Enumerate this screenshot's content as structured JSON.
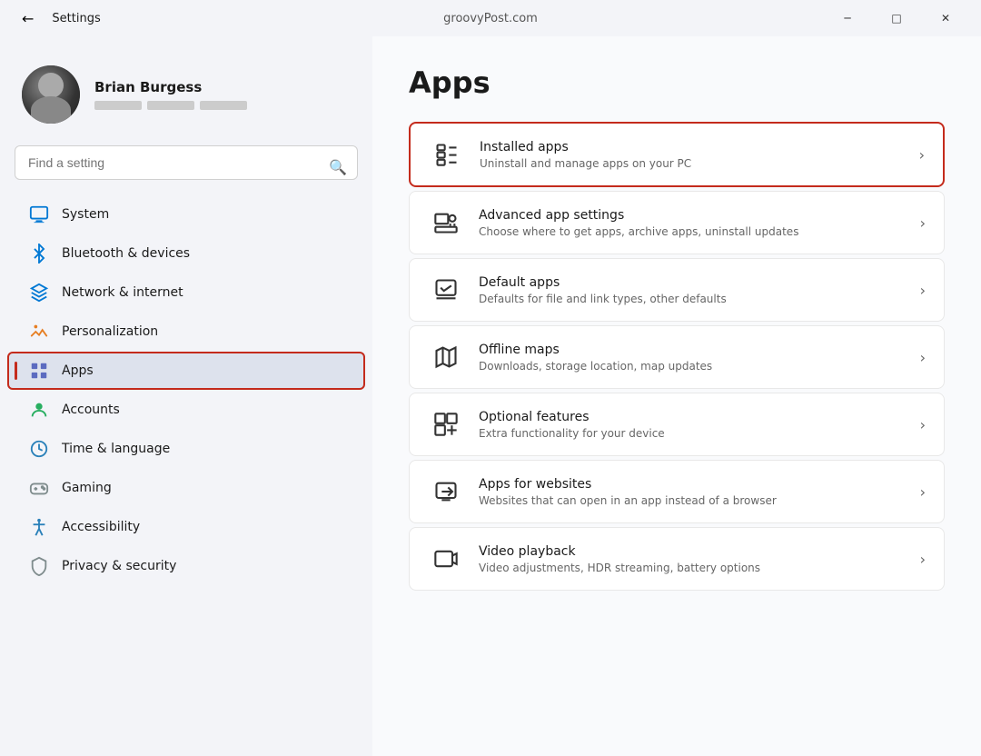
{
  "titlebar": {
    "back_label": "←",
    "title": "Settings",
    "url": "groovyPost.com",
    "minimize_label": "─",
    "maximize_label": "□",
    "close_label": "✕"
  },
  "sidebar": {
    "search_placeholder": "Find a setting",
    "profile": {
      "name": "Brian Burgess"
    },
    "nav_items": [
      {
        "id": "system",
        "label": "System",
        "icon_type": "system"
      },
      {
        "id": "bluetooth",
        "label": "Bluetooth & devices",
        "icon_type": "bluetooth"
      },
      {
        "id": "network",
        "label": "Network & internet",
        "icon_type": "network"
      },
      {
        "id": "personalization",
        "label": "Personalization",
        "icon_type": "personalization"
      },
      {
        "id": "apps",
        "label": "Apps",
        "icon_type": "apps",
        "active": true
      },
      {
        "id": "accounts",
        "label": "Accounts",
        "icon_type": "accounts"
      },
      {
        "id": "time",
        "label": "Time & language",
        "icon_type": "time"
      },
      {
        "id": "gaming",
        "label": "Gaming",
        "icon_type": "gaming"
      },
      {
        "id": "accessibility",
        "label": "Accessibility",
        "icon_type": "accessibility"
      },
      {
        "id": "privacy",
        "label": "Privacy & security",
        "icon_type": "privacy"
      }
    ]
  },
  "main": {
    "page_title": "Apps",
    "settings": [
      {
        "id": "installed-apps",
        "title": "Installed apps",
        "description": "Uninstall and manage apps on your PC",
        "highlighted": true
      },
      {
        "id": "advanced-app-settings",
        "title": "Advanced app settings",
        "description": "Choose where to get apps, archive apps, uninstall updates",
        "highlighted": false
      },
      {
        "id": "default-apps",
        "title": "Default apps",
        "description": "Defaults for file and link types, other defaults",
        "highlighted": false
      },
      {
        "id": "offline-maps",
        "title": "Offline maps",
        "description": "Downloads, storage location, map updates",
        "highlighted": false
      },
      {
        "id": "optional-features",
        "title": "Optional features",
        "description": "Extra functionality for your device",
        "highlighted": false
      },
      {
        "id": "apps-for-websites",
        "title": "Apps for websites",
        "description": "Websites that can open in an app instead of a browser",
        "highlighted": false
      },
      {
        "id": "video-playback",
        "title": "Video playback",
        "description": "Video adjustments, HDR streaming, battery options",
        "highlighted": false
      }
    ]
  }
}
